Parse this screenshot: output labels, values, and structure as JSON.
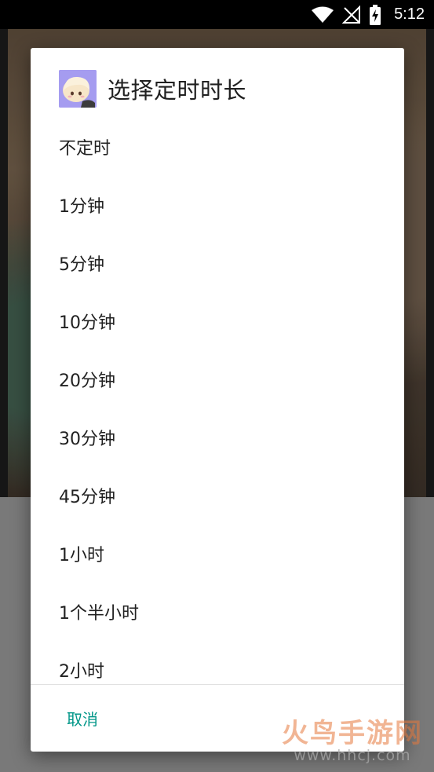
{
  "status_bar": {
    "time": "5:12",
    "icons": [
      "wifi-icon",
      "no-signal-icon",
      "battery-charging-icon"
    ]
  },
  "dialog": {
    "app_icon": "anime-avatar-icon",
    "title": "选择定时时长",
    "options": [
      {
        "label": "不定时"
      },
      {
        "label": "1分钟"
      },
      {
        "label": "5分钟"
      },
      {
        "label": "10分钟"
      },
      {
        "label": "20分钟"
      },
      {
        "label": "30分钟"
      },
      {
        "label": "45分钟"
      },
      {
        "label": "1小时"
      },
      {
        "label": "1个半小时"
      },
      {
        "label": "2小时"
      }
    ],
    "cancel_label": "取消",
    "accent_color": "#009688"
  },
  "watermark": {
    "brand": "火鸟手游网",
    "url": "www.hhcj.com"
  }
}
